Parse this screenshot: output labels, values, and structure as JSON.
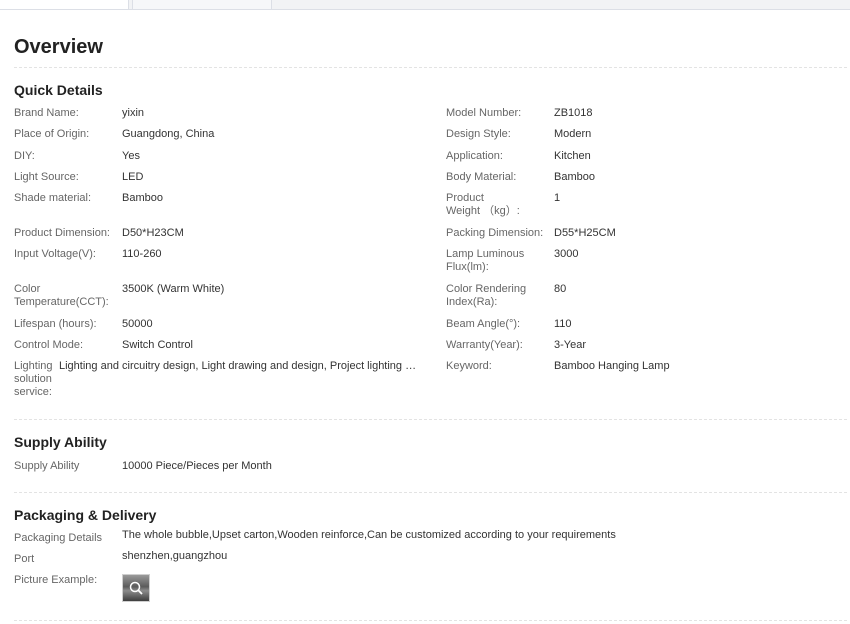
{
  "page": {
    "title": "Overview"
  },
  "quick_details": {
    "heading": "Quick Details",
    "left": [
      {
        "label": "Brand Name:",
        "value": "yixin"
      },
      {
        "label": "Place of Origin:",
        "value": "Guangdong, China"
      },
      {
        "label": "DIY:",
        "value": "Yes"
      },
      {
        "label": "Light Source:",
        "value": "LED"
      },
      {
        "label": "Shade material:",
        "value": "Bamboo"
      },
      {
        "label": "Product Dimension:",
        "value": "D50*H23CM"
      },
      {
        "label": "Input Voltage(V):",
        "value": "110-260"
      },
      {
        "label": "Color Temperature(CCT):",
        "value": "3500K (Warm White)"
      },
      {
        "label": "Lifespan (hours):",
        "value": "50000"
      },
      {
        "label": "Control Mode:",
        "value": "Switch Control"
      },
      {
        "label": "Lighting solution service:",
        "value": "Lighting and circuitry design, Light drawing and design, Project lighting design"
      }
    ],
    "right": [
      {
        "label": "Model Number:",
        "value": "ZB1018"
      },
      {
        "label": "Design Style:",
        "value": "Modern"
      },
      {
        "label": "Application:",
        "value": "Kitchen"
      },
      {
        "label": "Body Material:",
        "value": "Bamboo"
      },
      {
        "label": "Product Weight （kg）:",
        "value": "1"
      },
      {
        "label": "Packing Dimension:",
        "value": "D55*H25CM"
      },
      {
        "label": "Lamp Luminous Flux(lm):",
        "value": "3000"
      },
      {
        "label": "Color Rendering Index(Ra):",
        "value": "80"
      },
      {
        "label": "Beam Angle(°):",
        "value": "110"
      },
      {
        "label": "Warranty(Year):",
        "value": "3-Year"
      },
      {
        "label": "Keyword:",
        "value": "Bamboo Hanging Lamp"
      }
    ]
  },
  "supply_ability": {
    "heading": "Supply Ability",
    "rows": [
      {
        "label": "Supply Ability",
        "value": "10000 Piece/Pieces per Month"
      }
    ]
  },
  "packaging": {
    "heading": "Packaging & Delivery",
    "rows": [
      {
        "label": "Packaging Details",
        "value": "The whole bubble,Upset carton,Wooden reinforce,Can be customized according to your requirements"
      },
      {
        "label": "Port",
        "value": "shenzhen,guangzhou"
      },
      {
        "label": "Picture Example:",
        "value": ""
      }
    ],
    "picture_icon": "zoom-icon"
  }
}
